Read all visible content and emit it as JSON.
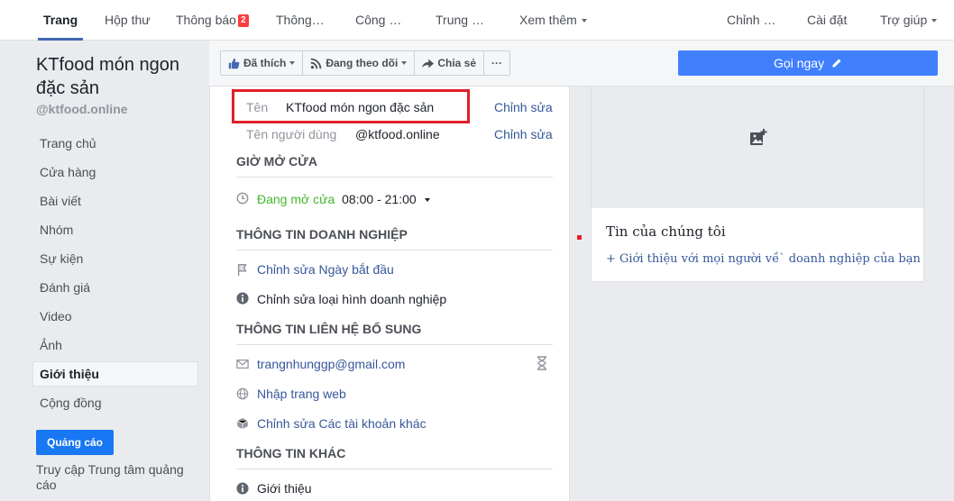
{
  "tabs": {
    "page": "Trang",
    "inbox": "Hộp thư",
    "notifications": "Thông báo",
    "notifications_count": "2",
    "info": "Thông…",
    "tools": "Công …",
    "center": "Trung …",
    "more": "Xem thêm",
    "edit": "Chỉnh …",
    "settings": "Cài đặt",
    "help": "Trợ giúp"
  },
  "sidebar": {
    "page_name": "KTfood món ngon đặc sản",
    "handle": "@ktfood.online",
    "items": [
      {
        "label": "Trang chủ"
      },
      {
        "label": "Cửa hàng"
      },
      {
        "label": "Bài viết"
      },
      {
        "label": "Nhóm"
      },
      {
        "label": "Sự kiện"
      },
      {
        "label": "Đánh giá"
      },
      {
        "label": "Video"
      },
      {
        "label": "Ảnh"
      },
      {
        "label": "Giới thiệu"
      },
      {
        "label": "Cộng đồng"
      }
    ],
    "active_item": "Giới thiệu",
    "ads_button": "Quảng cáo",
    "ads_center_link": "Truy cập Trung tâm quảng cáo"
  },
  "actions": {
    "liked": "Đã thích",
    "following": "Đang theo dõi",
    "share": "Chia sẻ",
    "more": "···",
    "call_now": "Gọi ngay"
  },
  "about": {
    "name_label": "Tên",
    "name_value": "KTfood món ngon đặc sản",
    "username_label": "Tên người dùng",
    "username_value": "@ktfood.online",
    "edit_label": "Chỉnh sửa",
    "hours_title": "GIỜ MỞ CỬA",
    "open_status": "Đang mở cửa",
    "hours": "08:00 - 21:00",
    "business_title": "THÔNG TIN DOANH NGHIỆP",
    "edit_start_date": "Chỉnh sửa Ngày bắt đầu",
    "edit_business_type": "Chỉnh sửa loại hình doanh nghiệp",
    "contact_title": "THÔNG TIN LIÊN HỆ BỔ SUNG",
    "email": "trangnhunggp@gmail.com",
    "website": "Nhập trang web",
    "other_accounts": "Chỉnh sửa Các tài khoản khác",
    "other_title": "THÔNG TIN KHÁC",
    "intro": "Giới thiệu"
  },
  "story": {
    "title": "Tin của chúng tôi",
    "link": "+ Giới thiệu với mọi người về` doanh nghiệp của bạn"
  },
  "colors": {
    "accent": "#4267b2",
    "call_button": "#4080ff",
    "highlight": "#e0202a",
    "open_green": "#42b72a"
  }
}
